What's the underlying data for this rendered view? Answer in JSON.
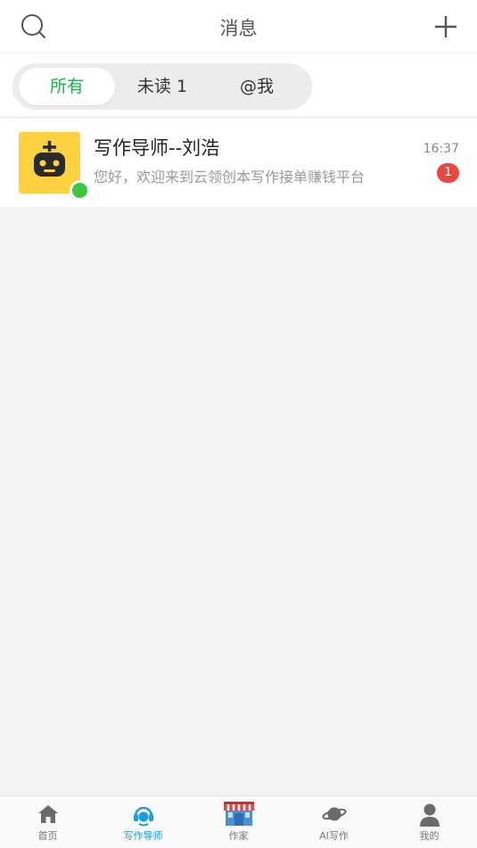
{
  "header": {
    "title": "消息",
    "search_icon": "search-icon",
    "add_icon": "plus-icon"
  },
  "filter_tabs": [
    {
      "label": "所有",
      "active": true
    },
    {
      "label": "未读 1",
      "active": false
    },
    {
      "label": "@我",
      "active": false
    }
  ],
  "conversations": [
    {
      "name": "写作导师--刘浩",
      "preview": "您好，欢迎来到云领创本写作接单赚钱平台",
      "time": "16:37",
      "unread": "1",
      "avatar_icon": "robot-icon",
      "online": true
    }
  ],
  "tabbar": [
    {
      "label": "首页",
      "icon": "home-icon",
      "active": false
    },
    {
      "label": "写作导师",
      "icon": "headset-icon",
      "active": true
    },
    {
      "label": "作家",
      "icon": "store-icon",
      "active": false
    },
    {
      "label": "AI写作",
      "icon": "planet-icon",
      "active": false
    },
    {
      "label": "我的",
      "icon": "user-icon",
      "active": false
    }
  ],
  "colors": {
    "accent_green": "#17b24a",
    "accent_blue": "#1c9ae6",
    "badge_red": "#ea4741",
    "avatar_yellow": "#ffd03f",
    "online_green": "#3ac93a"
  }
}
